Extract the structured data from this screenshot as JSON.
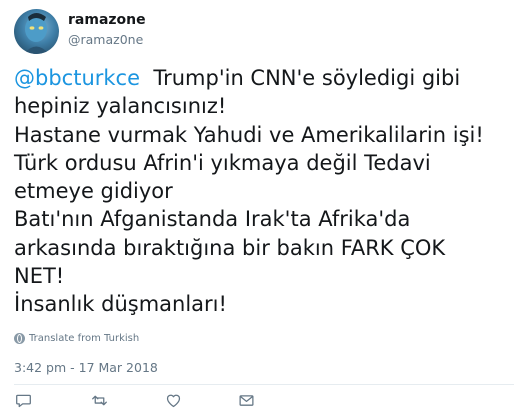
{
  "tweet": {
    "display_name": "ramazone",
    "handle": "@ramaz0ne",
    "mention": "@bbcturkce",
    "first_line_rest": "  Trump'in CNN'e söyledigi gibi",
    "lines": [
      "hepiniz yalancısınız!",
      "Hastane vurmak Yahudi ve Amerikalilarin işi!",
      "Türk ordusu Afrin'i yıkmaya değil Tedavi",
      "etmeye gidiyor",
      "Batı'nın Afganistanda Irak'ta Afrika'da",
      "arkasında bıraktığına bir bakın FARK ÇOK",
      "NET!",
      "İnsanlık düşmanları!"
    ],
    "translate_label": "Translate from Turkish",
    "timestamp": "3:42 pm - 17 Mar 2018"
  },
  "icons": {
    "avatar": "avatar-image",
    "translate": "globe-icon",
    "reply": "reply-icon",
    "retweet": "retweet-icon",
    "like": "heart-icon",
    "message": "envelope-icon"
  },
  "colors": {
    "link": "#1b95e0",
    "text": "#14171a",
    "secondary": "#657786"
  }
}
